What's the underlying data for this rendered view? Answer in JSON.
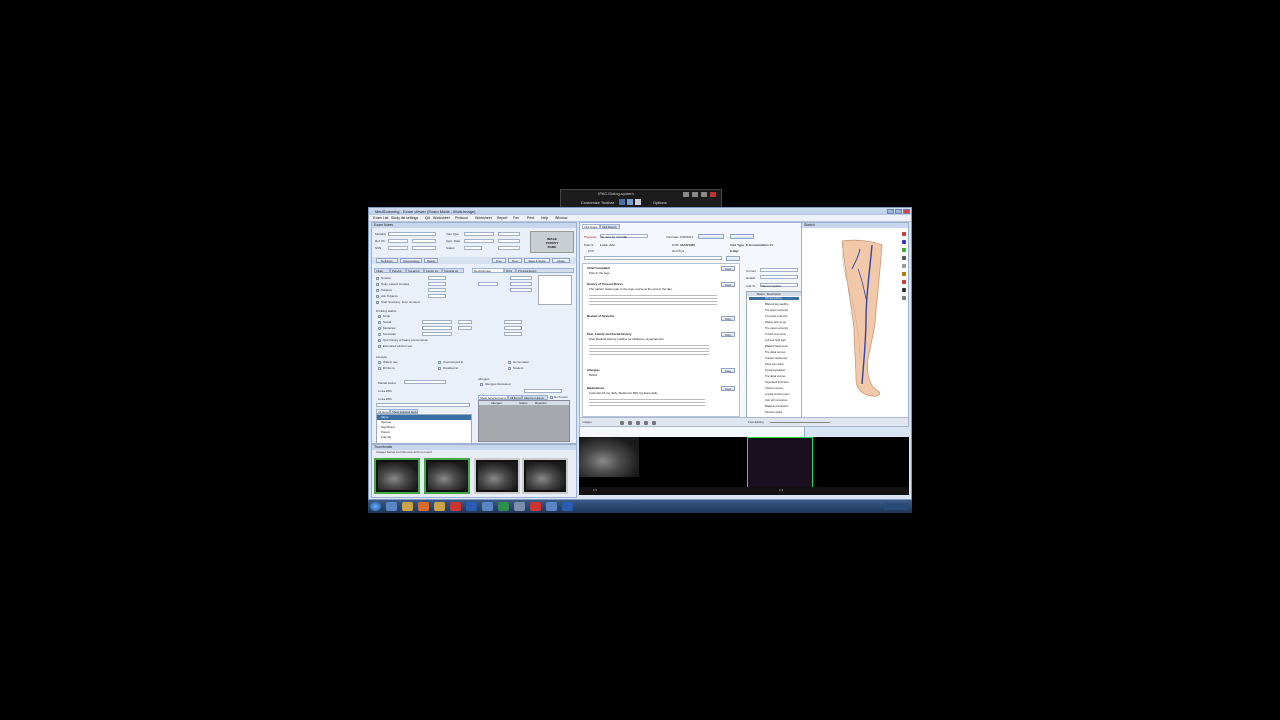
{
  "floating_toolbar": {
    "title": "IPAC Dialog-system",
    "customize": "Customize Toolbar",
    "options": "Options"
  },
  "window": {
    "title": "MedScanning - Exam viewer (Exam Mode - Multi-Image)"
  },
  "menu": [
    "Exam List",
    "Study list settings",
    "QA",
    "Worksheet",
    "Protocol",
    "Worksheet",
    "Report",
    "Fax",
    "Print",
    "Help",
    "Window"
  ],
  "left_panel": {
    "title": "Exam Notes",
    "fields": {
      "modality": "Modality",
      "ref_ph": "Ref. Ph.",
      "visit_type": "Visit Type",
      "status": "Status",
      "appt_date": "Appt. Date",
      "ssn": "SSN"
    },
    "header_box": [
      "IMAGE",
      "PATIENT",
      "NAME"
    ],
    "tabs": [
      "Vitals",
      "Pain/Hx",
      "Social Hx",
      "Family Hx",
      "Surgical Hx",
      "Med/Allergies",
      "ROS",
      "Physical Exam"
    ],
    "smoking": [
      "Smoker",
      "Daily, patient smokes",
      "Tobacco",
      "Ask Tobacco",
      "Start Smoking",
      "Ever smoked"
    ],
    "drinking": [
      "Drinking Habits",
      "Drink",
      "Social",
      "Moderate",
      "Teetotaler",
      "Quit history of heavy consumption",
      "Estimated alcohol use"
    ],
    "lifestyle": [
      "Lifestyle",
      "Widely use",
      "Drinks to",
      "Unemployed at",
      "Disabled at",
      "Homemaker",
      "Student"
    ],
    "marital_label": "Marital status",
    "living_label": "Lives With",
    "list_label": "Lives With",
    "allergies": "Allergies",
    "allergies_reviewed": "Allergies Reviewed",
    "alltabs": [
      "All Items",
      "Show selected items"
    ],
    "list_items": [
      "Alone",
      "Spouse",
      "Significant",
      "Parent",
      "Friends"
    ],
    "allergy_tabs": [
      "Show Selected Items",
      "All Items",
      "Allergies History",
      "No Known"
    ],
    "allergy_cols": [
      "Allergen",
      "Status",
      "Reaction"
    ],
    "buttons": [
      "Definition",
      "Cosmetology",
      "Ready",
      "Prev",
      "Next",
      "Save & Close",
      "Close"
    ]
  },
  "center_panel": {
    "tabs": [
      "Visit Notes",
      "Visit Report"
    ],
    "physician": "Physician",
    "physician_val": "Dr. Doe M. Test ME",
    "visit_date": "Visit Date",
    "visit_date_val": "6/28/2012",
    "patient_label": "Patient",
    "patient": "Lowe, Ann",
    "dob": "DOB",
    "dob_val": "04/05/1965",
    "pcp": "PCP",
    "ref_phys": "Ref Phys",
    "visit_type": "Visit Type",
    "visit_type_val": "E-Mgt",
    "ms_label": "E-Consumables-Tx",
    "sections": [
      {
        "title": "Chief Complaint",
        "text": "Pain in the legs"
      },
      {
        "title": "History of Present Illness",
        "text": "The patient states pain in the legs, worse at the end of the day."
      },
      {
        "title": "Review of Systems",
        "text": ""
      },
      {
        "title": "Past, Family and Social History",
        "text": "Past Medical History positive for Diabetes, Hypertension"
      },
      {
        "title": "Allergies",
        "text": "NKDA"
      },
      {
        "title": "Medications",
        "text": "Lisinopril 10 mg daily; Metformin 500 mg twice daily"
      }
    ],
    "copy_btn": "Copy",
    "right_fields": [
      "Current",
      "Details",
      "Add To",
      "Chief Complaint"
    ],
    "code_header": [
      "Macro",
      "Description"
    ],
    "codes": [
      "PD Symptoms",
      "Bilateral leg swelling",
      "The upper extremity",
      "The lower extremity",
      "Plaque with no sig",
      "The upper extremity",
      "Limited vein study",
      "Left and right legs",
      "Bilateral hand exam",
      "The distal venous",
      "Greater saphenous",
      "Deep vein reflux",
      "Femoral popliteal",
      "The distal venous",
      "Superficial thrombus",
      "Chronic venous",
      "Limited venous exam",
      "Vein with compress",
      "Bilateral comparison",
      "Sentinel nodes"
    ],
    "bottom_btns": [
      "Go to Evaluation",
      "Save",
      "Preview",
      "Close"
    ]
  },
  "right_panel": {
    "title": "Sketch",
    "hint": "Right leg anterior view"
  },
  "thumbnails": {
    "title": "Thumbnails",
    "sub": "Images  Series List  Remove all from report"
  },
  "viewer": {
    "frames": "Images",
    "status": "Fast Editing",
    "pager": [
      "1/1",
      "1/1"
    ]
  },
  "colors": {
    "bg": "#000000",
    "window": "#d9e4f2",
    "accent": "#3a6ea5",
    "thumb_border": "#3ea84a"
  }
}
